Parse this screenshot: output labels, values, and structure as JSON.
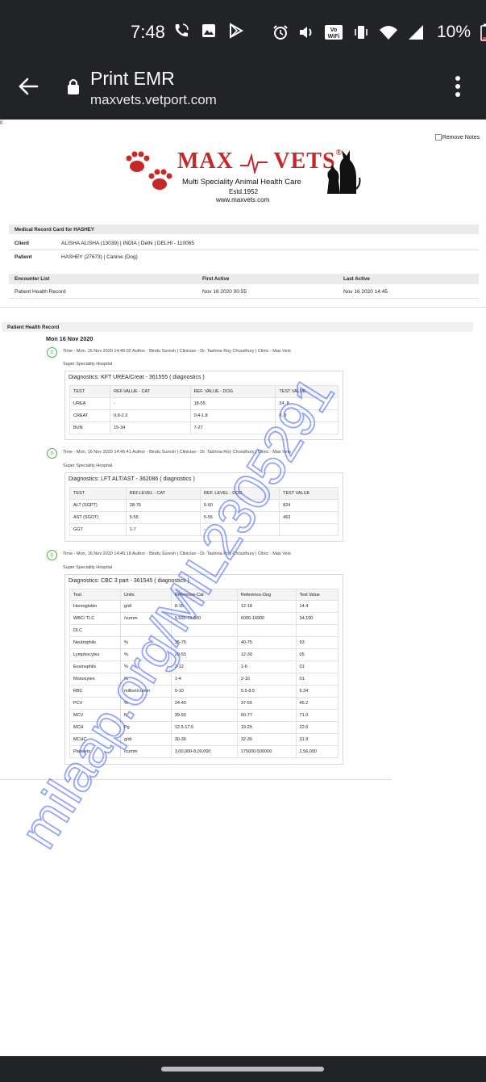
{
  "status": {
    "time": "7:48",
    "battery": "10%",
    "vowifi": "Vo\nWiFi"
  },
  "appbar": {
    "title": "Print EMR",
    "url": "maxvets.vetport.com"
  },
  "page": {
    "zero": "0",
    "remove_notes": "Remove Notes",
    "logo": {
      "brand_a": "MAX",
      "brand_b": "VETS",
      "reg": "®",
      "subtitle": "Multi Speciality Animal Health Care",
      "estd": "Estd.1952",
      "website": "www.maxvets.com"
    },
    "record": {
      "heading": "Medical Record Card for HASHEY",
      "client_label": "Client",
      "client_value": "ALISHA ALISHA (13039) | INDIA | Delhi | DELHI - 110065",
      "patient_label": "Patient",
      "patient_value": "HASHEY (27673) | Canine (Dog)"
    },
    "encounter": {
      "col1": "Encounter List",
      "col2": "First Active",
      "col3": "Last Active",
      "row_name": "Patient Health Record",
      "first": "Nov 16 2020 00:55",
      "last": "Nov 16 2020 14:45"
    },
    "phr_heading": "Patient Health Record",
    "date": "Mon 16 Nov 2020",
    "entries": [
      {
        "circle": "D",
        "meta": "Time - Mon, 16 Nov 2020 14:46:02 Author - Bindu Suresh | Clinician - Dr. Tashina Roy Choudhury | Clinic - Max Vets",
        "sub": "Super Speciality Hospital",
        "title": "Diagnostics: KFT UREA/Creat - 361555 ( diagnostics )",
        "headers": [
          "TEST",
          "REF.VALUE - CAT",
          "REF. VALUE - DOG",
          "TEST VALUE"
        ],
        "rows": [
          [
            "UREA",
            "-",
            "18-55",
            "34. 8"
          ],
          [
            "CREAT",
            "0.8-2.3",
            "0.4-1.8",
            "0. 8"
          ],
          [
            "BUN",
            "15-34",
            "7-27",
            ""
          ]
        ]
      },
      {
        "circle": "D",
        "meta": "Time - Mon, 16 Nov 2020 14:45:41 Author - Bindu Suresh | Clinician - Dr. Tashina Roy Choudhury | Clinic - Max Vets",
        "sub": "Super Speciality Hospital",
        "title": "Diagnostics: LFT ALT/AST - 362086 ( diagnostics )",
        "headers": [
          "TEST",
          "REF.LEVEL - CAT",
          "REF. LEVEL - DOG",
          "TEST VALUE"
        ],
        "rows": [
          [
            "ALT (SGPT)",
            "28-76",
            "5-60",
            "824"
          ],
          [
            "AST (SGOT)",
            "5-55",
            "5-55",
            "463"
          ],
          [
            "GGT",
            "1-7",
            "-",
            ""
          ]
        ]
      },
      {
        "circle": "D",
        "meta": "Time - Mon, 16 Nov 2020 14:45:18 Author - Bindu Suresh | Clinician - Dr. Tashina Roy Choudhury | Clinic - Max Vets",
        "sub": "Super Speciality Hospital",
        "title": "Diagnostics: CBC 3 part - 361545 ( diagnostics )",
        "headers": [
          "Test",
          "Units",
          "Reference-Cat",
          "Reference-Dog",
          "Test Value"
        ],
        "rows": [
          [
            "Hemoglobin",
            "g/dl",
            "8-15",
            "12-18",
            "14.4"
          ],
          [
            "WBC/ TLC",
            "/cumm",
            "5,500-19,500",
            "6000-16900",
            "34,100"
          ],
          [
            "DLC",
            "",
            "",
            "",
            ""
          ],
          [
            "Neutrophils",
            "%",
            "35-75",
            "40-75",
            "93"
          ],
          [
            "Lymphocytes",
            "%",
            "20-55",
            "12-30",
            "05"
          ],
          [
            "Eosinophils",
            "%",
            "2-12",
            "1-6",
            "01"
          ],
          [
            "Monocytes",
            "%",
            "1-4",
            "2-10",
            "01"
          ],
          [
            "RBC",
            "million/cumm",
            "5-10",
            "5.5-8.5",
            "6.34"
          ],
          [
            "PCV",
            "%",
            "24-45",
            "37-55",
            "45.2"
          ],
          [
            "MCV",
            "fl",
            "39-55",
            "60-77",
            "71.0"
          ],
          [
            "MCH",
            "Pg",
            "12.5-17.5",
            "19-25",
            "22.6"
          ],
          [
            "MCHC",
            "g/dl",
            "30-36",
            "32-36",
            "31.9"
          ],
          [
            "Platelets",
            "/cumm",
            "3,00,000-8,00,000",
            "175000-500000",
            "2,56,000"
          ]
        ]
      }
    ]
  },
  "watermark": "milaap.org/MIL2305291",
  "colors": {
    "bar": "#222326",
    "brand_red": "#c62828",
    "badge_green": "#4caf50",
    "watermark": "#3d5afe"
  }
}
